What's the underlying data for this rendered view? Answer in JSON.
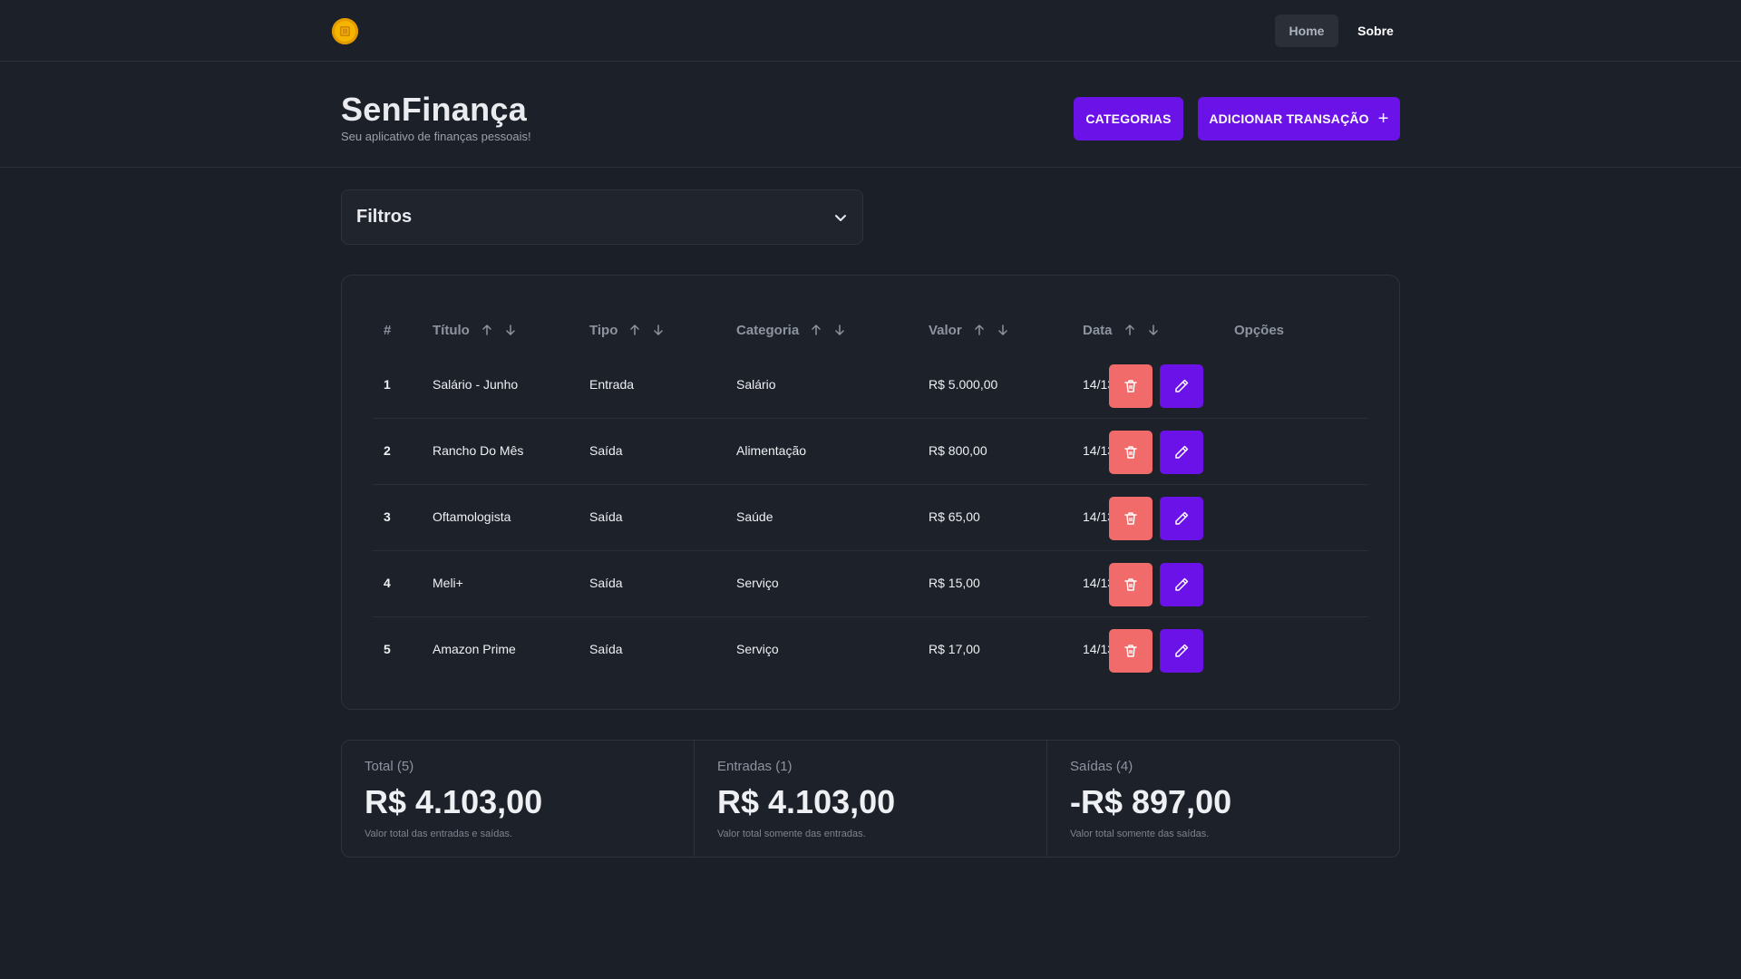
{
  "nav": {
    "logo_icon": "coin-icon",
    "home_label": "Home",
    "sobre_label": "Sobre"
  },
  "header": {
    "title": "SenFinança",
    "subtitle": "Seu aplicativo de finanças pessoais!",
    "categorias_label": "CATEGORIAS",
    "add_label": "ADICIONAR TRANSAÇÃO",
    "add_icon": "plus-icon"
  },
  "filters": {
    "label": "Filtros",
    "icon": "chevron-down-icon"
  },
  "table": {
    "columns": {
      "num": "#",
      "titulo": "Título",
      "tipo": "Tipo",
      "categoria": "Categoria",
      "valor": "Valor",
      "data": "Data",
      "opcoes": "Opções"
    },
    "rows": [
      {
        "num": "1",
        "titulo": "Salário - Junho",
        "tipo": "Entrada",
        "categoria": "Salário",
        "valor": "R$ 5.000,00",
        "data": "14/13/2024"
      },
      {
        "num": "2",
        "titulo": "Rancho Do Mês",
        "tipo": "Saída",
        "categoria": "Alimentação",
        "valor": "R$ 800,00",
        "data": "14/13/2024"
      },
      {
        "num": "3",
        "titulo": "Oftamologista",
        "tipo": "Saída",
        "categoria": "Saúde",
        "valor": "R$ 65,00",
        "data": "14/13/2024"
      },
      {
        "num": "4",
        "titulo": "Meli+",
        "tipo": "Saída",
        "categoria": "Serviço",
        "valor": "R$ 15,00",
        "data": "14/13/2024"
      },
      {
        "num": "5",
        "titulo": "Amazon Prime",
        "tipo": "Saída",
        "categoria": "Serviço",
        "valor": "R$ 17,00",
        "data": "14/13/2024"
      }
    ]
  },
  "summary": {
    "total": {
      "label": "Total (5)",
      "value": "R$ 4.103,00",
      "desc": "Valor total das entradas e saídas."
    },
    "entradas": {
      "label": "Entradas (1)",
      "value": "R$ 4.103,00",
      "desc": "Valor total somente das entradas."
    },
    "saidas": {
      "label": "Saídas (4)",
      "value": "-R$ 897,00",
      "desc": "Valor total somente das saídas."
    }
  },
  "colors": {
    "accent": "#6a12e8",
    "danger": "#f16b6b",
    "background": "#1b1f27",
    "logo": "#f4b400"
  }
}
